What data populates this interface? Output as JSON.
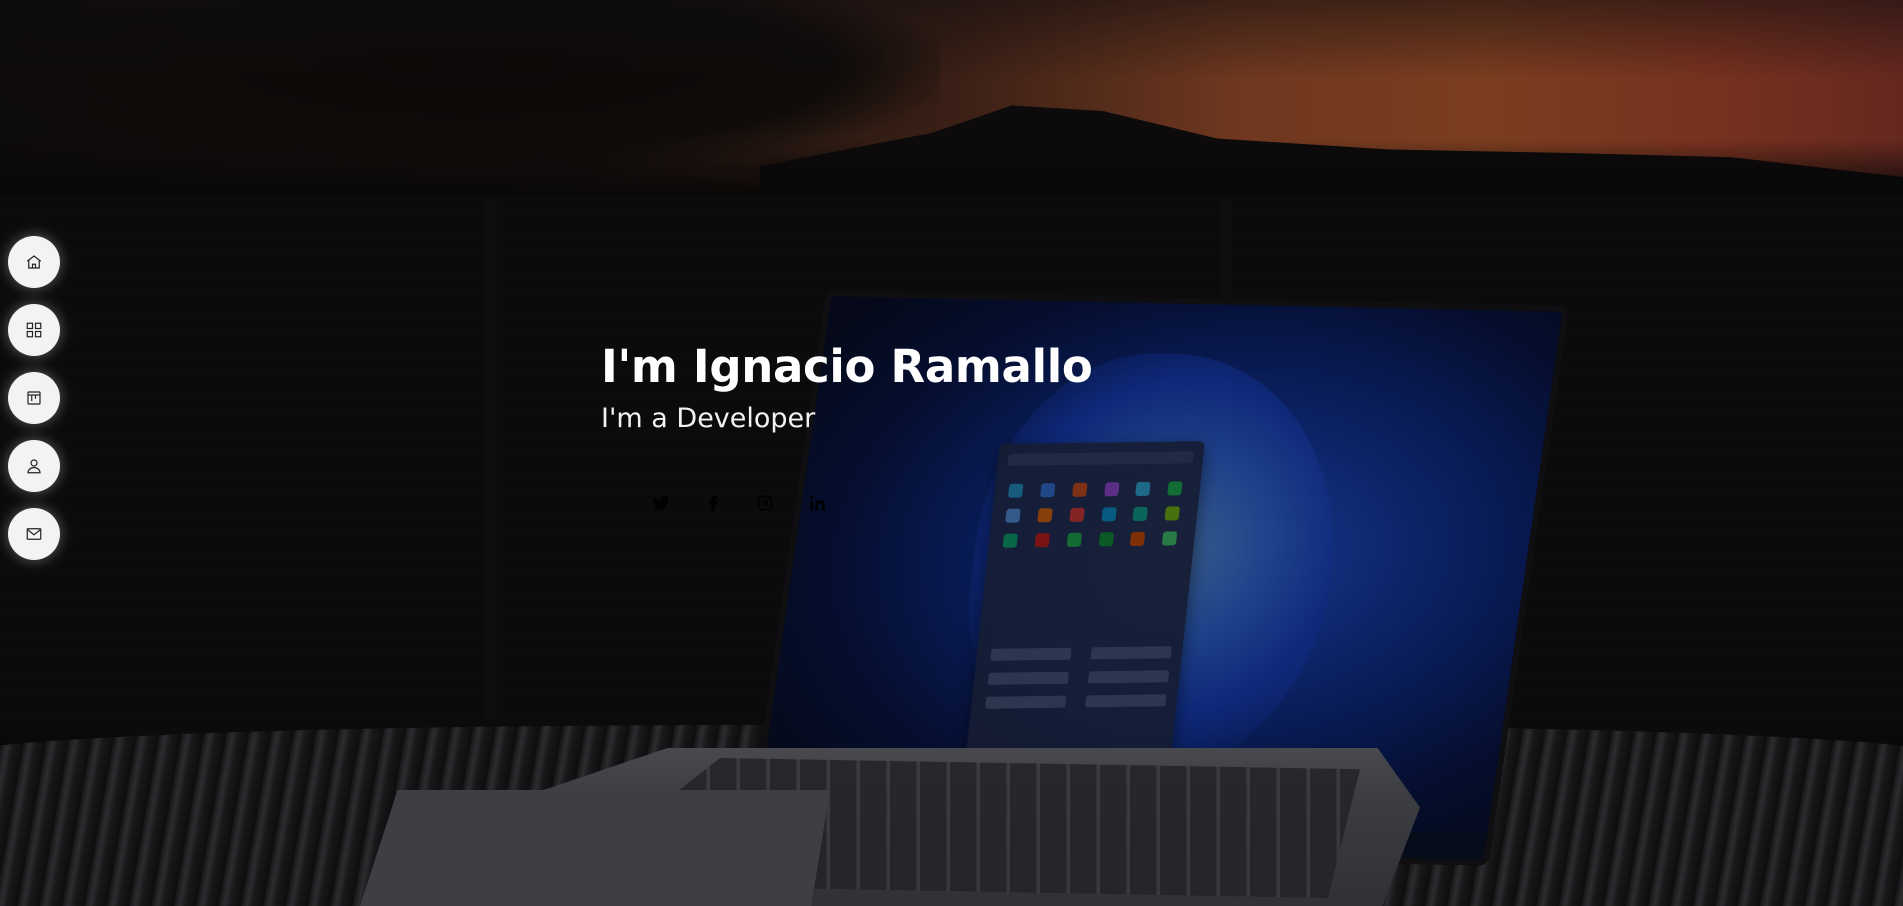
{
  "hero": {
    "title": "I'm Ignacio Ramallo",
    "subtitle": "I'm a Developer"
  },
  "side_nav": {
    "items": [
      {
        "icon": "home-icon"
      },
      {
        "icon": "grid-icon"
      },
      {
        "icon": "portfolio-icon"
      },
      {
        "icon": "user-icon"
      },
      {
        "icon": "mail-icon"
      }
    ]
  },
  "socials": [
    {
      "icon": "twitter-icon"
    },
    {
      "icon": "facebook-icon"
    },
    {
      "icon": "instagram-icon"
    },
    {
      "icon": "linkedin-icon"
    }
  ],
  "colors": {
    "nav_button_bg": "#f3f3f5",
    "title_color": "#ffffff",
    "social_icon_color": "#000000"
  }
}
